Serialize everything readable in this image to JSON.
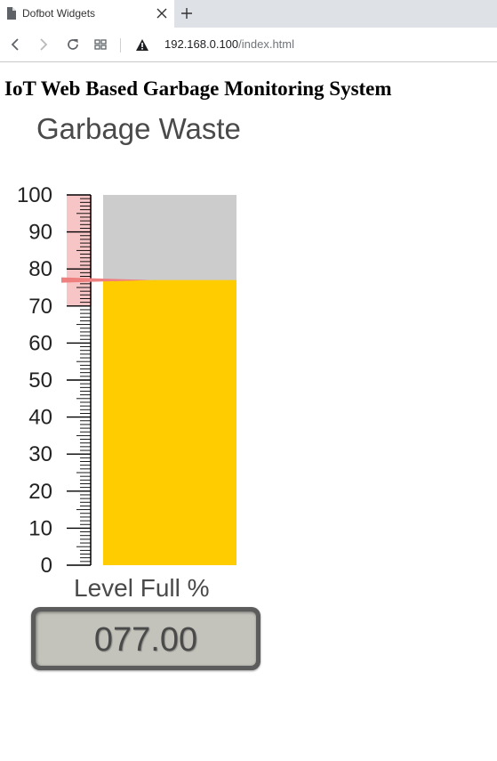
{
  "browser": {
    "tab_title": "Dofbot Widgets",
    "url_host": "192.168.0.100",
    "url_path": "/index.html"
  },
  "page": {
    "heading": "IoT Web Based Garbage Monitoring System"
  },
  "gauge": {
    "title": "Garbage Waste",
    "label": "Level Full %",
    "display_value": "077.00",
    "level": 77,
    "min": 0,
    "max": 100,
    "tick_labels": [
      "0",
      "10",
      "20",
      "30",
      "40",
      "50",
      "60",
      "70",
      "80",
      "90",
      "100"
    ],
    "alarm_zone": [
      70,
      100
    ],
    "colors": {
      "fill": "#ffcc00",
      "empty": "#cccccc",
      "alarm": "#f7c5c5",
      "marker": "#ef8080"
    }
  }
}
